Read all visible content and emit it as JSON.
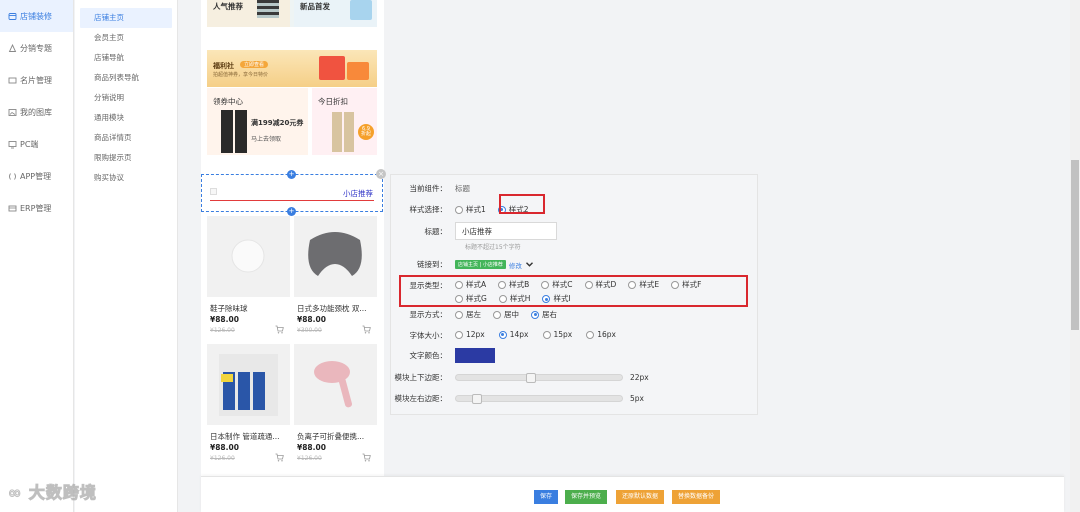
{
  "nav": {
    "items": [
      {
        "label": "店铺装修",
        "icon": "palette-icon",
        "active": true
      },
      {
        "label": "分销专题",
        "icon": "share-icon"
      },
      {
        "label": "名片管理",
        "icon": "card-icon"
      },
      {
        "label": "我的图库",
        "icon": "image-icon"
      },
      {
        "label": "PC端",
        "icon": "monitor-icon"
      },
      {
        "label": "APP管理",
        "icon": "app-icon"
      },
      {
        "label": "ERP管理",
        "icon": "erp-icon"
      }
    ],
    "subitems": [
      "店铺主页",
      "会员主页",
      "店铺导航",
      "商品列表导航",
      "分销说明",
      "通用模块",
      "商品详情页",
      "限购提示页",
      "购买协议"
    ]
  },
  "preview": {
    "banner_left": "人气推荐",
    "banner_right": "新品首发",
    "fuli_title": "福利社",
    "fuli_tag": "立即查看",
    "fuli_sub": "拍超值神券，享今日特价",
    "coupon_title": "领券中心",
    "coupon_main": "满199减20元券",
    "coupon_sub": "马上去领取",
    "discount_title": "今日折扣",
    "discount_badge_num": "6.9",
    "discount_badge_txt": "折起",
    "selected_title": "小店推荐",
    "products": [
      {
        "name": "鞋子除味球",
        "price": "¥88.00",
        "old": "¥126.00"
      },
      {
        "name": "日式多功能颈枕 双...",
        "price": "¥88.00",
        "old": "¥300.00"
      },
      {
        "name": "日本制作 管道疏通...",
        "price": "¥88.00",
        "old": "¥126.00"
      },
      {
        "name": "负离子可折叠便携...",
        "price": "¥88.00",
        "old": "¥126.00"
      }
    ]
  },
  "panel": {
    "current_label": "当前组件：",
    "current_value": "标题",
    "style_label": "样式选择：",
    "style_options": [
      "样式1",
      "样式2"
    ],
    "style_selected": 1,
    "title_label": "标题：",
    "title_value": "小店推荐",
    "title_hint": "标题不超过15个字符",
    "link_label": "链接到：",
    "link_badge": "店铺主页 | 小店推荐",
    "link_edit": "修改",
    "display_type_label": "显示类型：",
    "display_types": [
      "样式A",
      "样式B",
      "样式C",
      "样式D",
      "样式E",
      "样式F",
      "样式G",
      "样式H",
      "样式I"
    ],
    "display_type_selected": 8,
    "align_label": "显示方式：",
    "align_options": [
      "居左",
      "居中",
      "居右"
    ],
    "align_selected": 2,
    "font_label": "字体大小：",
    "font_options": [
      "12px",
      "14px",
      "15px",
      "16px"
    ],
    "font_selected": 1,
    "color_label": "文字颜色：",
    "color_value": "#2b3aa3",
    "vpad_label": "模块上下边距：",
    "vpad_value": "22px",
    "vpad_fraction": 0.44,
    "hpad_label": "模块左右边距：",
    "hpad_value": "5px",
    "hpad_fraction": 0.1
  },
  "buttons": {
    "save": "保存",
    "save_preview": "保存并预览",
    "restore": "还原默认数据",
    "replace": "替换数据备份"
  },
  "watermark": "大数跨境"
}
